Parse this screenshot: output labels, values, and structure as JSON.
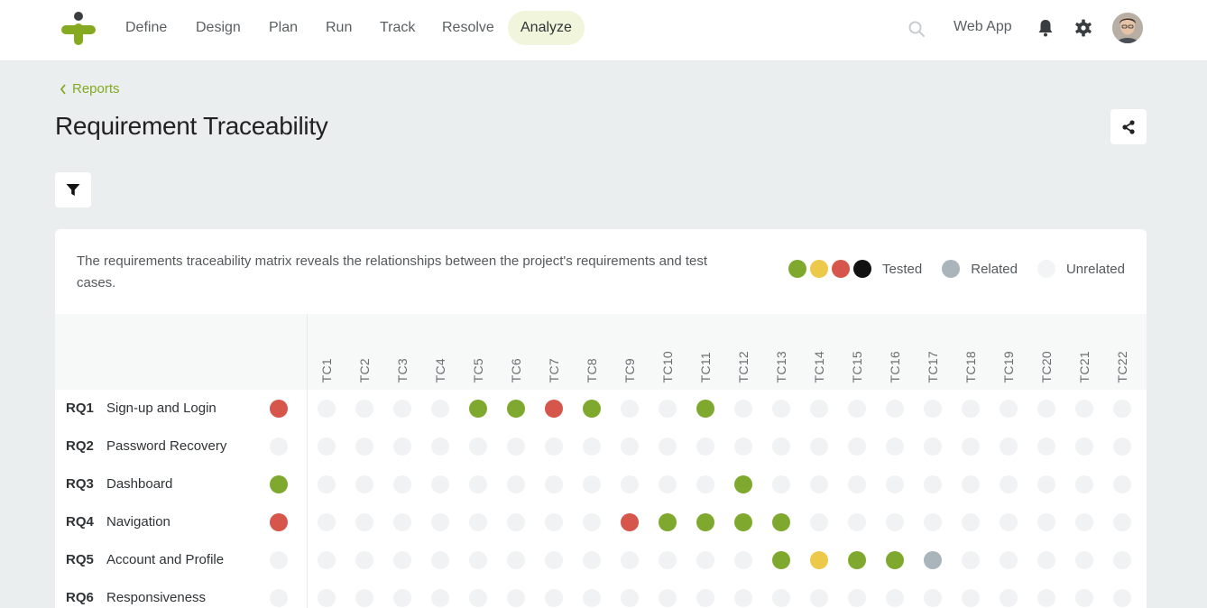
{
  "nav": {
    "items": [
      {
        "label": "Define"
      },
      {
        "label": "Design"
      },
      {
        "label": "Plan"
      },
      {
        "label": "Run"
      },
      {
        "label": "Track"
      },
      {
        "label": "Resolve"
      },
      {
        "label": "Analyze",
        "active": true
      }
    ],
    "project": "Web App",
    "icons": [
      "search-icon",
      "bell-icon",
      "gear-icon"
    ]
  },
  "breadcrumb": {
    "label": "Reports"
  },
  "page": {
    "title": "Requirement Traceability"
  },
  "card": {
    "description": "The requirements traceability matrix reveals the relationships between the project's requirements and test cases.",
    "legend": {
      "tested": "Tested",
      "related": "Related",
      "unrelated": "Unrelated"
    }
  },
  "colors": {
    "pass": "#7fa92e",
    "fail": "#d7564b",
    "warn": "#ecc94b",
    "untested": "#111111",
    "related": "#aab4bb",
    "unrelated": "#f1f2f3",
    "accent": "#86a922"
  },
  "matrix": {
    "test_cases": [
      "TC1",
      "TC2",
      "TC3",
      "TC4",
      "TC5",
      "TC6",
      "TC7",
      "TC8",
      "TC9",
      "TC10",
      "TC11",
      "TC12",
      "TC13",
      "TC14",
      "TC15",
      "TC16",
      "TC17",
      "TC18",
      "TC19",
      "TC20",
      "TC21",
      "TC22"
    ],
    "requirements": [
      {
        "id": "RQ1",
        "name": "Sign-up and Login",
        "status": "fail",
        "cells": {
          "TC5": "pass",
          "TC6": "pass",
          "TC7": "fail",
          "TC8": "pass",
          "TC11": "pass"
        }
      },
      {
        "id": "RQ2",
        "name": "Password Recovery",
        "status": "none",
        "cells": {}
      },
      {
        "id": "RQ3",
        "name": "Dashboard",
        "status": "pass",
        "cells": {
          "TC12": "pass"
        }
      },
      {
        "id": "RQ4",
        "name": "Navigation",
        "status": "fail",
        "cells": {
          "TC9": "fail",
          "TC10": "pass",
          "TC11": "pass",
          "TC12": "pass",
          "TC13": "pass"
        }
      },
      {
        "id": "RQ5",
        "name": "Account and Profile",
        "status": "none",
        "cells": {
          "TC13": "pass",
          "TC14": "warn",
          "TC15": "pass",
          "TC16": "pass",
          "TC17": "related"
        }
      },
      {
        "id": "RQ6",
        "name": "Responsiveness",
        "status": "none",
        "cells": {}
      }
    ]
  }
}
